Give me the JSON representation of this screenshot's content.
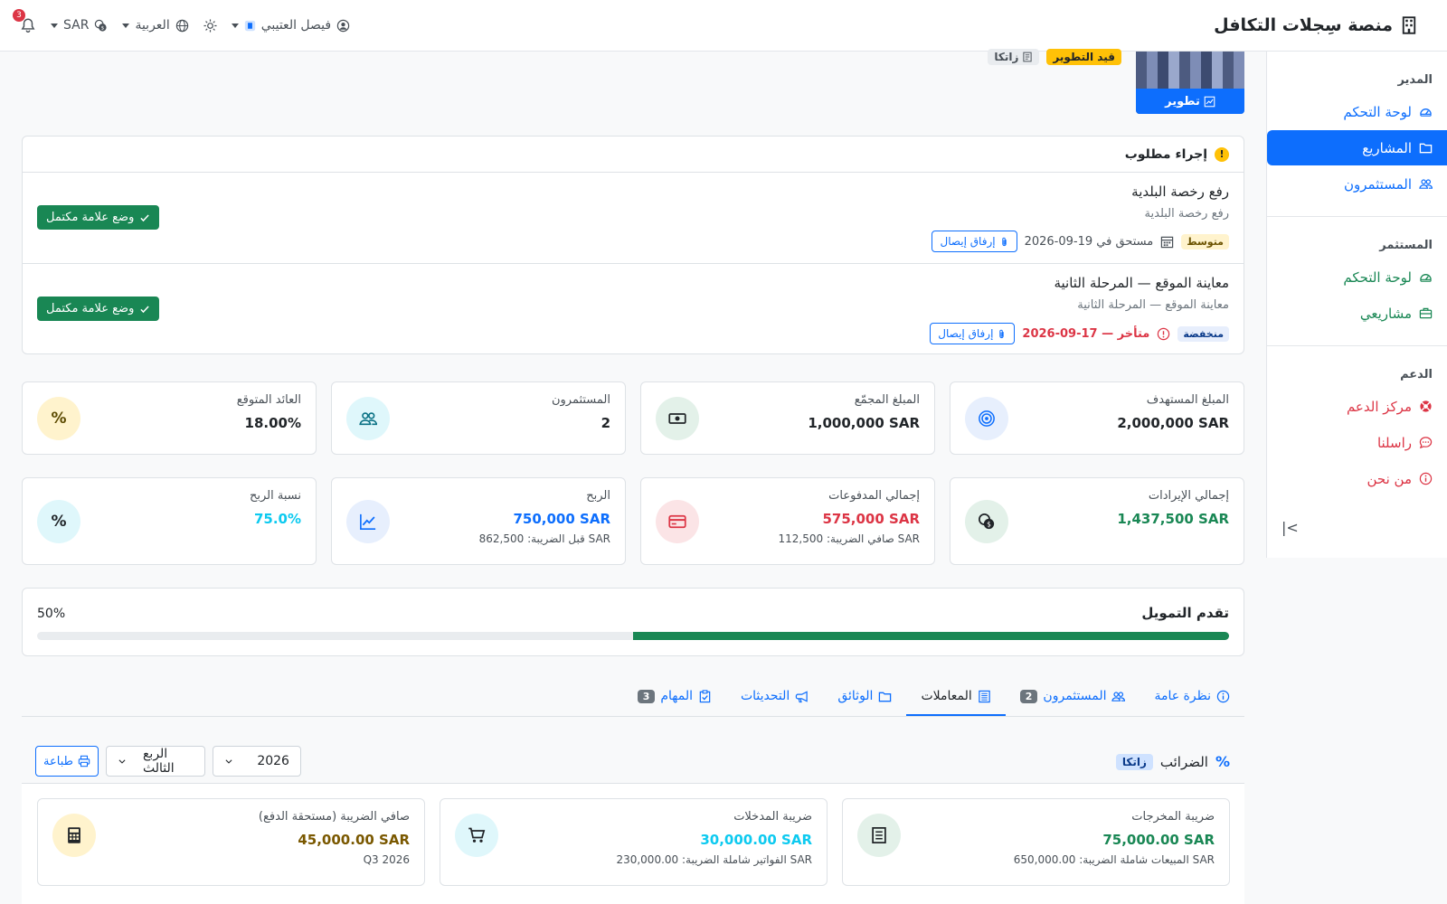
{
  "app": {
    "title": "منصة سِجلات التكافل"
  },
  "topbar": {
    "user": "فيصل العتيبي",
    "language": "العربية",
    "currency": "SAR",
    "notifications_count": "3"
  },
  "sidebar": {
    "sections": [
      {
        "heading": "المدير",
        "items": [
          {
            "label": "لوحة التحكم"
          },
          {
            "label": "المشاريع"
          },
          {
            "label": "المستثمرون"
          }
        ]
      },
      {
        "heading": "المستثمر",
        "items": [
          {
            "label": "لوحة التحكم"
          },
          {
            "label": "مشاريعي"
          }
        ]
      },
      {
        "heading": "الدعم",
        "items": [
          {
            "label": "مركز الدعم"
          },
          {
            "label": "راسلنا"
          },
          {
            "label": "من نحن"
          }
        ]
      }
    ],
    "collapse_label": "|<"
  },
  "project": {
    "status_label": "تطوير",
    "tags": [
      "قيد التطوير",
      "زاتكا"
    ]
  },
  "actions": {
    "title": "إجراء مطلوب",
    "tasks": [
      {
        "title": "رفع رخصة البلدية",
        "subtitle": "رفع رخصة البلدية",
        "priority": "متوسط",
        "due": "مستحق في 19-09-2026",
        "attach": "إرفاق إيصال",
        "complete": "وضع علامة مكتمل"
      },
      {
        "title": "معاينة الموقع — المرحلة الثانية",
        "subtitle": "معاينة الموقع — المرحلة الثانية",
        "priority": "منخفضة",
        "due": "متأخر — 17-09-2026",
        "attach": "إرفاق إيصال",
        "complete": "وضع علامة مكتمل"
      }
    ]
  },
  "stats": [
    {
      "label": "المبلغ المستهدف",
      "value": "2,000,000 SAR"
    },
    {
      "label": "المبلغ المجمّع",
      "value": "1,000,000 SAR"
    },
    {
      "label": "المستثمرون",
      "value": "2"
    },
    {
      "label": "العائد المتوقع",
      "value": "18.00%"
    }
  ],
  "stats2": [
    {
      "label": "إجمالي الإيرادات",
      "value": "1,437,500 SAR",
      "sub": ""
    },
    {
      "label": "إجمالي المدفوعات",
      "value": "575,000 SAR",
      "sub": "صافي الضريبة: 112,500 SAR"
    },
    {
      "label": "الربح",
      "value": "750,000 SAR",
      "sub": "قبل الضريبة: 862,500 SAR"
    },
    {
      "label": "نسبة الربح",
      "value": "75.0%",
      "sub": ""
    }
  ],
  "progress": {
    "title": "تقدم التمويل",
    "percent_label": "50%",
    "value": 50
  },
  "tabs": [
    {
      "label": "نظرة عامة",
      "count": ""
    },
    {
      "label": "المستثمرون",
      "count": "2"
    },
    {
      "label": "المعاملات",
      "count": ""
    },
    {
      "label": "الوثائق",
      "count": ""
    },
    {
      "label": "التحديثات",
      "count": ""
    },
    {
      "label": "المهام",
      "count": "3"
    }
  ],
  "taxes": {
    "title": "الضرائب",
    "tag": "زاتكا",
    "year": "2026",
    "quarter": "الربع الثالث",
    "print": "طباعة",
    "cards": [
      {
        "label": "ضريبة المخرجات",
        "value": "75,000.00 SAR",
        "sub": "المبيعات شاملة الضريبة: 650,000.00 SAR"
      },
      {
        "label": "ضريبة المدخلات",
        "value": "30,000.00 SAR",
        "sub": "الفواتير شاملة الضريبة: 230,000.00 SAR"
      },
      {
        "label": "صافي الضريبة (مستحقة الدفع)",
        "value": "45,000.00 SAR",
        "sub": "Q3 2026"
      }
    ]
  },
  "colors": {
    "primary": "#0d6efd",
    "success": "#198754",
    "danger": "#dc3545",
    "warning": "#ffc107",
    "info": "#0dcaf0"
  }
}
